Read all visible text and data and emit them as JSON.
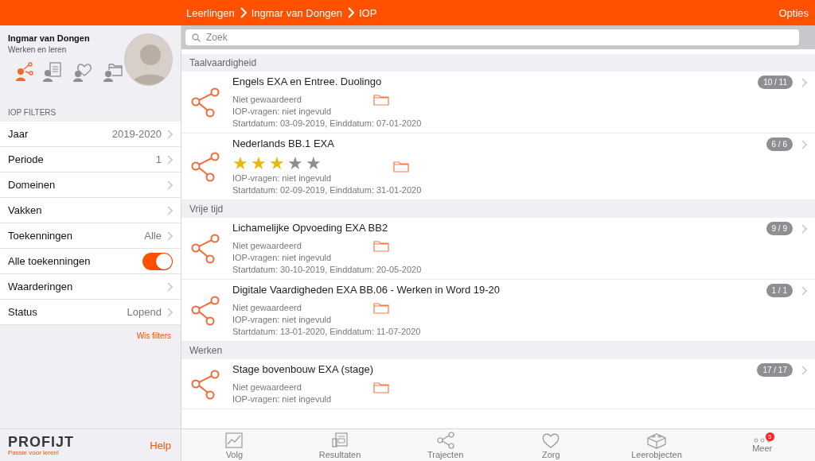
{
  "topbar": {
    "breadcrumbs": [
      "Leerlingen",
      "Ingmar van Dongen",
      "IOP"
    ],
    "options": "Opties"
  },
  "profile": {
    "name": "Ingmar van Dongen",
    "subtitle": "Werken en leren",
    "tabs": [
      {
        "kind": "trajecten",
        "selected": true
      },
      {
        "kind": "resultaten",
        "selected": false
      },
      {
        "kind": "zorg",
        "selected": false
      },
      {
        "kind": "map",
        "selected": false
      }
    ]
  },
  "filters": {
    "title": "IOP FILTERS",
    "items": [
      {
        "kind": "value",
        "label": "Jaar",
        "value": "2019-2020"
      },
      {
        "kind": "value",
        "label": "Periode",
        "value": "1"
      },
      {
        "kind": "value",
        "label": "Domeinen"
      },
      {
        "kind": "value",
        "label": "Vakken"
      },
      {
        "kind": "value",
        "label": "Toekenningen",
        "value": "Alle"
      },
      {
        "kind": "toggle",
        "label": "Alle toekenningen",
        "on": true
      },
      {
        "kind": "value",
        "label": "Waarderingen"
      },
      {
        "kind": "value",
        "label": "Status",
        "value": "Lopend"
      }
    ],
    "clear": "Wis filters"
  },
  "search": {
    "placeholder": "Zoek"
  },
  "sections": [
    {
      "title": "Taalvaardigheid",
      "items": [
        {
          "title": "Engels EXA en Entree. Duolingo",
          "badge": "10 / 11",
          "rating": "Niet gewaardeerd",
          "questions": "IOP-vragen: niet ingevuld",
          "dates": "Startdatum: 03-09-2019, Einddatum: 07-01-2020"
        },
        {
          "title": "Nederlands BB.1 EXA",
          "badge": "6 / 6",
          "stars": 3,
          "questions": "IOP-vragen: niet ingevuld",
          "dates": "Startdatum: 02-09-2019, Einddatum: 31-01-2020"
        }
      ]
    },
    {
      "title": "Vrije tijd",
      "items": [
        {
          "title": "Lichamelijke Opvoeding EXA BB2",
          "badge": "9 / 9",
          "rating": "Niet gewaardeerd",
          "questions": "IOP-vragen: niet ingevuld",
          "dates": "Startdatum: 30-10-2019, Einddatum: 20-05-2020"
        },
        {
          "title": "Digitale Vaardigheden EXA BB.06 - Werken in Word 19-20",
          "badge": "1 / 1",
          "rating": "Niet gewaardeerd",
          "questions": "IOP-vragen: niet ingevuld",
          "dates": "Startdatum: 13-01-2020, Einddatum: 11-07-2020"
        }
      ]
    },
    {
      "title": "Werken",
      "items": [
        {
          "title": "Stage bovenbouw EXA (stage)",
          "badge": "17 / 17",
          "rating": "Niet gewaardeerd",
          "questions": "IOP-vragen: niet ingevuld"
        }
      ]
    }
  ],
  "footer": {
    "logo": "PROFIJT",
    "tagline": "Passie voor leren!",
    "help": "Help"
  },
  "tabbar": [
    {
      "kind": "chart",
      "label": "Volg"
    },
    {
      "kind": "doc",
      "label": "Resultaten"
    },
    {
      "kind": "share",
      "label": "Trajecten"
    },
    {
      "kind": "heart",
      "label": "Zorg"
    },
    {
      "kind": "brick",
      "label": "Leerobjecten"
    },
    {
      "kind": "dots",
      "label": "Meer",
      "badge": "5"
    }
  ]
}
